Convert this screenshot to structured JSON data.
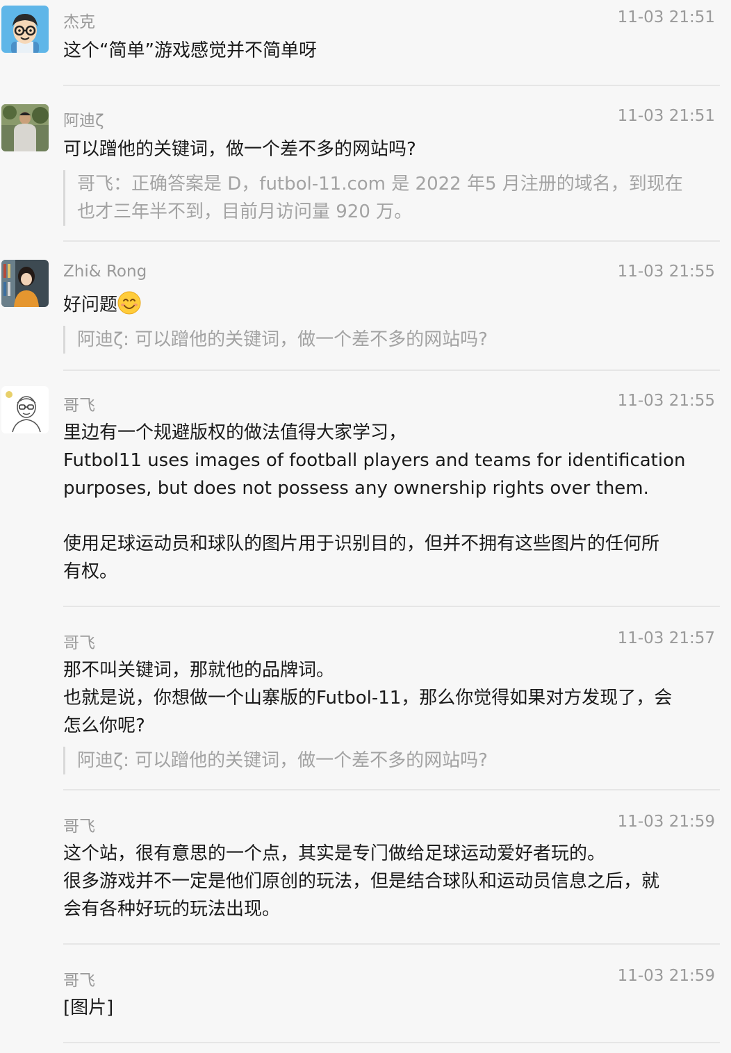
{
  "comments": [
    {
      "name": "杰克",
      "time": "11-03 21:51",
      "body": [
        "这个“简单”游戏感觉并不简单呀"
      ]
    },
    {
      "name": "阿迪ζ",
      "time": "11-03 21:51",
      "body": [
        "可以蹭他的关键词，做一个差不多的网站吗?"
      ],
      "quote": [
        "哥飞：正确答案是 D，futbol-11.com 是 2022 年5 月注册的域名，到现在",
        "也才三年半不到，目前月访问量 920 万。"
      ]
    },
    {
      "name": "Zhi& Rong",
      "time": "11-03 21:55",
      "body": [
        "好问题"
      ],
      "emoji": "smiling-face",
      "quote": [
        "阿迪ζ: 可以蹭他的关键词，做一个差不多的网站吗?"
      ]
    },
    {
      "name": "哥飞",
      "time": "11-03 21:55",
      "body": [
        "里边有一个规避版权的做法值得大家学习，",
        "Futbol11 uses images of football players and teams for identification",
        "purposes, but does not possess any ownership rights over them.",
        "",
        "使用足球运动员和球队的图片用于识别目的，但并不拥有这些图片的任何所",
        "有权。"
      ]
    },
    {
      "name": "哥飞",
      "time": "11-03 21:57",
      "body": [
        "那不叫关键词，那就他的品牌词。",
        "也就是说，你想做一个山寨版的Futbol-11，那么你觉得如果对方发现了，会",
        "怎么你呢?"
      ],
      "quote": [
        "阿迪ζ: 可以蹭他的关键词，做一个差不多的网站吗?"
      ]
    },
    {
      "name": "哥飞",
      "time": "11-03 21:59",
      "body": [
        "这个站，很有意思的一个点，其实是专门做给足球运动爱好者玩的。",
        "很多游戏并不一定是他们原创的玩法，但是结合球队和运动员信息之后，就",
        "会有各种好玩的玩法出现。"
      ]
    },
    {
      "name": "哥飞",
      "time": "11-03 21:59",
      "body": [
        "[图片]"
      ]
    }
  ]
}
